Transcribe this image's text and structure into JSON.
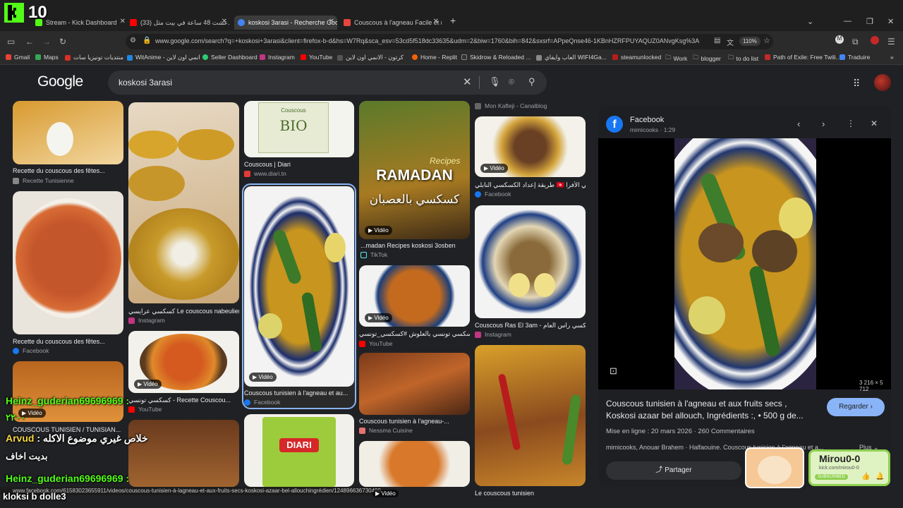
{
  "tabs": [
    {
      "title": "Stream - Kick Dashboard",
      "color": "#53fc18"
    },
    {
      "title": "(33) عشت 48 ساعة في بيت مثل...",
      "color": "#ff0000"
    },
    {
      "title": "koskosi 3arasi - Recherche Google",
      "color": "#4285f4"
    },
    {
      "title": "Couscous à l'agneau Facile et ra...",
      "color": "#e8453c"
    }
  ],
  "url": "www.google.com/search?q=+koskosi+3arasi&client=firefox-b-d&hs=W7Rq&sca_esv=53cd5f518dc33635&udm=2&biw=1760&bih=842&sxsrf=APpeQnse46-1KBnHZRFPUYAQUZ0ANvgKsg%3A",
  "zoom": "110%",
  "bookmarks": [
    {
      "label": "Gmail",
      "color": "#ea4335"
    },
    {
      "label": "Maps",
      "color": "#34a853"
    },
    {
      "label": "منتديات تونيزيا سات",
      "color": "#d93025"
    },
    {
      "label": "WitAnime - انمي اون لاين",
      "color": "#1e88e5"
    },
    {
      "label": "Seller Dashboard",
      "color": "#2ecc71"
    },
    {
      "label": "Instagram",
      "color": "#c13584"
    },
    {
      "label": "YouTube",
      "color": "#ff0000"
    },
    {
      "label": "كرتون - الانمي اون لاين",
      "color": "#555"
    },
    {
      "label": "Home - Replit",
      "color": "#f26207"
    },
    {
      "label": "Skidrow & Reloaded ...",
      "color": "#333"
    },
    {
      "label": "العاب وايفاي WIFI4Ga...",
      "color": "#888"
    },
    {
      "label": "steamunlocked",
      "color": "#b71c1c"
    },
    {
      "label": "Work",
      "color": "#777"
    },
    {
      "label": "blogger",
      "color": "#777"
    },
    {
      "label": "to do list",
      "color": "#777"
    },
    {
      "label": "Path of Exile: Free Twili...",
      "color": "#c62828"
    },
    {
      "label": "Traduire",
      "color": "#4285f4"
    }
  ],
  "google": {
    "logo": "Google",
    "query": "koskosi 3arasi"
  },
  "results": {
    "col1": [
      {
        "caption": "Recette du couscous des fêtes...",
        "source": "Recette Tunisienne",
        "src_color": "#888"
      },
      {
        "caption": "Recette du couscous des fêtes...",
        "source": "Facebook",
        "src_color": "#1877f2"
      },
      {
        "caption": "COUSCOUS TUNISIEN / TUNISIAN...",
        "source": "",
        "src_color": "#888",
        "badge": "Vidéo"
      }
    ],
    "col2": [
      {
        "caption": "كسكسي عرايسي Le couscous nabeulien...",
        "source": "Instagram",
        "src_color": "#c13584"
      },
      {
        "caption": "كسكسي تونسي - Recette Couscou...",
        "source": "YouTube",
        "src_color": "#ff0000",
        "badge": "Vidéo"
      }
    ],
    "col3": [
      {
        "caption": "Couscous | Diari",
        "source": "www.diari.tn",
        "src_color": "#e53935"
      },
      {
        "caption": "Couscous tunisien à l'agneau et au...",
        "source": "Facebook",
        "src_color": "#1877f2",
        "badge": "Vidéo"
      }
    ],
    "col4": [
      {
        "caption": "...madan Recipes koskosi 3osben",
        "source": "TikTok",
        "src_color": "#222",
        "badge": "Vidéo",
        "overlay_title": "RAMADAN",
        "overlay_sub": "Recipes",
        "overlay_ar": "كسكسي بالعصبان"
      },
      {
        "caption": "كسكسي تونسي بالعلوش #كسكسي_تونسي",
        "source": "YouTube",
        "src_color": "#ff0000",
        "badge": "Vidéo"
      },
      {
        "caption": "Couscous tunisien à l'agneau-...",
        "source": "Nessma Cuisine",
        "src_color": "#e57373"
      },
      {
        "caption": "",
        "source": "",
        "badge": "Vidéo"
      }
    ],
    "col5": [
      {
        "caption": "طريقة إعداد الكسكسي النابلي 🇹🇳 كسكسي الأفرا...",
        "source": "Facebook",
        "src_color": "#1877f2",
        "badge": "Vidéo",
        "top_source": "Mon Kafteji - Canalblog"
      },
      {
        "caption": "Couscous Ras El 3am - كسكسي راس العام",
        "source": "Instagram",
        "src_color": "#c13584"
      },
      {
        "caption": "Le couscous tunisien",
        "source": "",
        "src_color": "#888"
      }
    ],
    "diari_label": "DIARI",
    "bio_label": "BIO",
    "bio_brand": "Couscous"
  },
  "panel": {
    "source_name": "Facebook",
    "source_sub": "mimicooks · 1:29",
    "dims": "3 216 × 5 712",
    "title": "Couscous tunisien à l'agneau et aux fruits secs , Koskosi azaar bel allouch, Ingrédients :, • 500 g de...",
    "visit_label": "Regarder",
    "posted": "Mise en ligne : 20 mars 2026 · 260 Commentaires",
    "tags": "mimicooks, Anouar Brahem · Halfaouine. Couscous tunisien à l'agneau et a...",
    "more_label": "Plus",
    "share_label": "Partager"
  },
  "stream": {
    "kick_count": "10",
    "chat": [
      {
        "user": "Heinz_guderian69696969",
        "msg": ":",
        "color": "#53fc18"
      },
      {
        "user": "",
        "msg": "٢٢٠٠",
        "color": "#53fc18"
      },
      {
        "user": "Arvud",
        "msg": ": خلاص غيري موضوع الاكله",
        "color": "#f6d743"
      },
      {
        "user": "",
        "msg": "بديت اخاف",
        "color": "#ffffff"
      },
      {
        "user": "Heinz_guderian69696969",
        "msg": ":",
        "color": "#53fc18"
      },
      {
        "user": "kloksi b dolle3",
        "msg": "",
        "color": "#ffffff"
      }
    ],
    "streamer_name": "Mirou0-0",
    "streamer_sub": "kick.com/mirou0-0",
    "subscribed": "SUBSCRIBED"
  },
  "status_url": "www.facebook.com/61583023655911/videos/couscous-tunisien-à-lagneau-et-aux-fruits-secs-koskosi-azaar-bel-allouchingrédien/1248966367304997/"
}
